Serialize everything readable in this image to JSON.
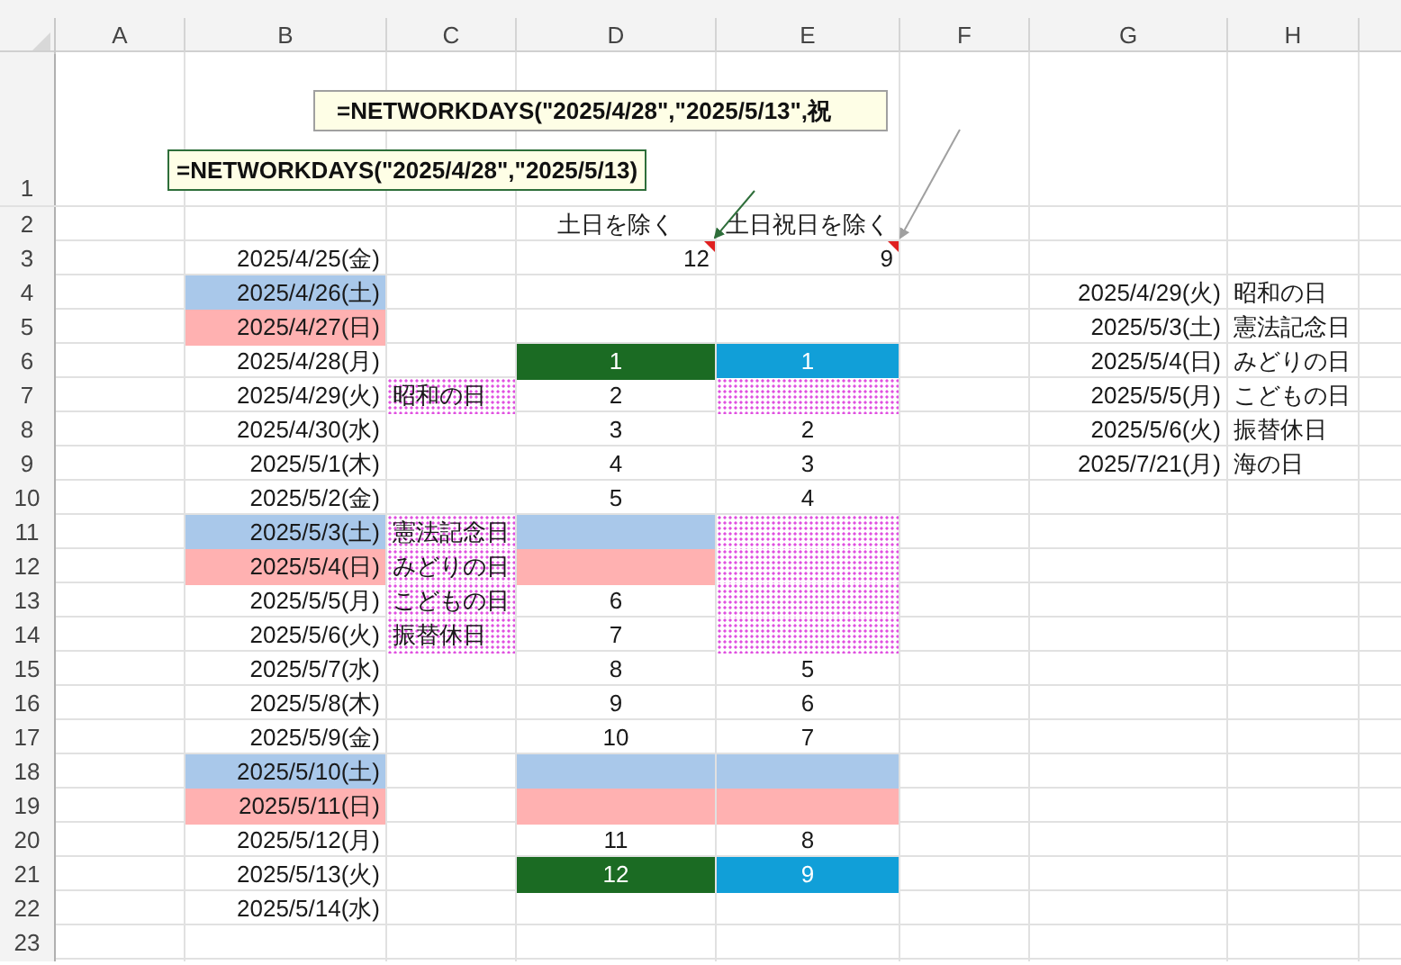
{
  "columns": [
    "A",
    "B",
    "C",
    "D",
    "E",
    "F",
    "G",
    "H"
  ],
  "rows": [
    {
      "number": "1"
    },
    {
      "number": "2",
      "cells": {
        "d": {
          "text": "土日を除く"
        },
        "e": {
          "text": "土日祝日を除く"
        }
      }
    },
    {
      "number": "3",
      "kind": "totals",
      "cells": {
        "b": {
          "text": "2025/4/25(金)"
        },
        "d": {
          "text": "12",
          "has_comment": true
        },
        "e": {
          "text": "9",
          "has_comment": true
        }
      }
    },
    {
      "number": "4",
      "cells": {
        "b": {
          "text": "2025/4/26(土)",
          "color": "#a9c8ea"
        },
        "g": {
          "text": "2025/4/29(火)"
        },
        "h": {
          "text": "昭和の日"
        }
      }
    },
    {
      "number": "5",
      "cells": {
        "b": {
          "text": "2025/4/27(日)",
          "color": "#ffb1b1"
        },
        "g": {
          "text": "2025/5/3(土)"
        },
        "h": {
          "text": "憲法記念日"
        }
      }
    },
    {
      "number": "6",
      "cells": {
        "b": {
          "text": "2025/4/28(月)"
        },
        "d": {
          "text": "1",
          "color": "#1b6b23"
        },
        "e": {
          "text": "1",
          "color": "#119fd8"
        },
        "g": {
          "text": "2025/5/4(日)"
        },
        "h": {
          "text": "みどりの日"
        }
      }
    },
    {
      "number": "7",
      "cells": {
        "b": {
          "text": "2025/4/29(火)"
        },
        "c": {
          "text": "昭和の日",
          "pattern": true
        },
        "d": {
          "text": "2"
        },
        "e": {
          "pattern": true
        },
        "g": {
          "text": "2025/5/5(月)"
        },
        "h": {
          "text": "こどもの日"
        }
      }
    },
    {
      "number": "8",
      "cells": {
        "b": {
          "text": "2025/4/30(水)"
        },
        "d": {
          "text": "3"
        },
        "e": {
          "text": "2"
        },
        "g": {
          "text": "2025/5/6(火)"
        },
        "h": {
          "text": "振替休日"
        }
      }
    },
    {
      "number": "9",
      "cells": {
        "b": {
          "text": "2025/5/1(木)"
        },
        "d": {
          "text": "4"
        },
        "e": {
          "text": "3"
        },
        "g": {
          "text": "2025/7/21(月)"
        },
        "h": {
          "text": "海の日"
        }
      }
    },
    {
      "number": "10",
      "cells": {
        "b": {
          "text": "2025/5/2(金)"
        },
        "d": {
          "text": "5"
        },
        "e": {
          "text": "4"
        }
      }
    },
    {
      "number": "11",
      "cells": {
        "b": {
          "text": "2025/5/3(土)",
          "color": "#a9c8ea"
        },
        "c": {
          "text": "憲法記念日",
          "pattern": true
        },
        "d": {
          "color": "#a9c8ea"
        },
        "e": {
          "pattern": true
        }
      }
    },
    {
      "number": "12",
      "cells": {
        "b": {
          "text": "2025/5/4(日)",
          "color": "#ffb1b1"
        },
        "c": {
          "text": "みどりの日",
          "pattern": true
        },
        "d": {
          "color": "#ffb1b1"
        },
        "e": {
          "pattern": true
        }
      }
    },
    {
      "number": "13",
      "cells": {
        "b": {
          "text": "2025/5/5(月)"
        },
        "c": {
          "text": "こどもの日",
          "pattern": true
        },
        "d": {
          "text": "6"
        },
        "e": {
          "pattern": true
        }
      }
    },
    {
      "number": "14",
      "cells": {
        "b": {
          "text": "2025/5/6(火)"
        },
        "c": {
          "text": "振替休日",
          "pattern": true
        },
        "d": {
          "text": "7"
        },
        "e": {
          "pattern": true
        }
      }
    },
    {
      "number": "15",
      "cells": {
        "b": {
          "text": "2025/5/7(水)"
        },
        "d": {
          "text": "8"
        },
        "e": {
          "text": "5"
        }
      }
    },
    {
      "number": "16",
      "cells": {
        "b": {
          "text": "2025/5/8(木)"
        },
        "d": {
          "text": "9"
        },
        "e": {
          "text": "6"
        }
      }
    },
    {
      "number": "17",
      "cells": {
        "b": {
          "text": "2025/5/9(金)"
        },
        "d": {
          "text": "10"
        },
        "e": {
          "text": "7"
        }
      }
    },
    {
      "number": "18",
      "cells": {
        "b": {
          "text": "2025/5/10(土)",
          "color": "#a9c8ea"
        },
        "d": {
          "color": "#a9c8ea"
        },
        "e": {
          "color": "#a9c8ea"
        }
      }
    },
    {
      "number": "19",
      "cells": {
        "b": {
          "text": "2025/5/11(日)",
          "color": "#ffb1b1"
        },
        "d": {
          "color": "#ffb1b1"
        },
        "e": {
          "color": "#ffb1b1"
        }
      }
    },
    {
      "number": "20",
      "cells": {
        "b": {
          "text": "2025/5/12(月)"
        },
        "d": {
          "text": "11"
        },
        "e": {
          "text": "8"
        }
      }
    },
    {
      "number": "21",
      "cells": {
        "b": {
          "text": "2025/5/13(火)"
        },
        "d": {
          "text": "12",
          "color": "#1b6b23"
        },
        "e": {
          "text": "9",
          "color": "#119fd8"
        }
      }
    },
    {
      "number": "22",
      "cells": {
        "b": {
          "text": "2025/5/14(水)"
        }
      }
    },
    {
      "number": "23"
    }
  ],
  "comments": [
    {
      "text": "=NETWORKDAYS(\"2025/4/28\",\"2025/5/13\",祝",
      "color": "#a0a0a0"
    },
    {
      "text": "=NETWORKDAYS(\"2025/4/28\",\"2025/5/13)",
      "color": "#2e6e3a"
    }
  ]
}
